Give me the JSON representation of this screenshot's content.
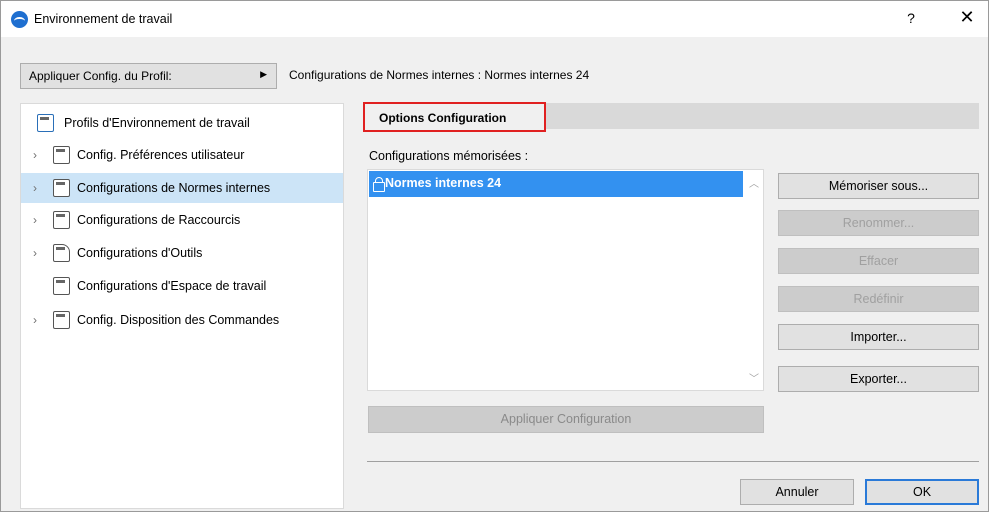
{
  "window": {
    "title": "Environnement de travail",
    "help_label": "?",
    "close_label": "✕"
  },
  "profile": {
    "apply_label": "Appliquer Config. du Profil:",
    "arrow": "▶",
    "current_config": "Configurations de Normes internes : Normes internes 24"
  },
  "tree": {
    "items": [
      {
        "label": "Profils d'Environnement de travail",
        "expander": "",
        "icon": "profile-icon"
      },
      {
        "label": "Config. Préférences utilisateur",
        "expander": "›",
        "icon": "user-prefs-icon"
      },
      {
        "label": "Configurations de Normes  internes",
        "expander": "›",
        "icon": "company-standards-icon"
      },
      {
        "label": "Configurations de Raccourcis",
        "expander": "›",
        "icon": "shortcuts-icon"
      },
      {
        "label": "Configurations d'Outils",
        "expander": "›",
        "icon": "tools-icon"
      },
      {
        "label": "Configurations d'Espace de travail",
        "expander": "",
        "icon": "workspace-icon"
      },
      {
        "label": "Config. Disposition des Commandes",
        "expander": "›",
        "icon": "command-layout-icon"
      }
    ],
    "selected_index": 2
  },
  "tab": {
    "label": "Options Configuration"
  },
  "saved": {
    "label": "Configurations mémorisées :",
    "items": [
      {
        "label": "Normes internes 24",
        "locked": true
      }
    ],
    "scroll_up": "︿",
    "scroll_down": "﹀"
  },
  "buttons": {
    "save_as": "Mémoriser sous...",
    "rename": "Renommer...",
    "delete": "Effacer",
    "redefine": "Redéfinir",
    "import": "Importer...",
    "export": "Exporter...",
    "apply_config": "Appliquer Configuration",
    "cancel": "Annuler",
    "ok": "OK"
  },
  "colors": {
    "accent": "#3391f0",
    "selection": "#cce4f7",
    "highlight_border": "#e02020"
  }
}
